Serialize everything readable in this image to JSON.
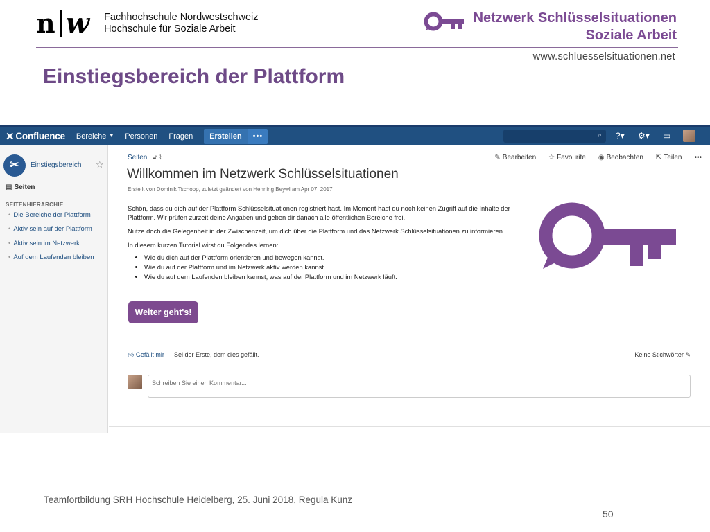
{
  "header": {
    "fhnw_mark": "n",
    "fhnw_mark_w": "w",
    "fhnw_line1": "Fachhochschule Nordwestschweiz",
    "fhnw_line2": "Hochschule für Soziale Arbeit",
    "network_line1": "Netzwerk Schlüsselsituationen",
    "network_line2": "Soziale Arbeit",
    "network_url": "www.schluesselsituationen.net",
    "brand_color": "#7b4a93"
  },
  "slide": {
    "title": "Einstiegsbereich der Plattform",
    "footer": "Teamfortbildung SRH Hochschule Heidelberg, 25. Juni 2018, Regula Kunz",
    "page_number": "50"
  },
  "confluence": {
    "topbar": {
      "logo": "Confluence",
      "nav": [
        "Bereiche",
        "Personen",
        "Fragen"
      ],
      "create_label": "Erstellen",
      "more_label": "•••"
    },
    "sidebar": {
      "space_name": "Einstiegsbereich",
      "pages_label": "Seiten",
      "hierarchy_label": "SEITENHIERARCHIE",
      "tree": [
        "Die Bereiche der Plattform",
        "Aktiv sein auf der Plattform",
        "Aktiv sein im Netzwerk",
        "Auf dem Laufenden bleiben"
      ]
    },
    "page": {
      "breadcrumb": "Seiten",
      "actions": [
        "Bearbeiten",
        "Favourite",
        "Beobachten",
        "Teilen"
      ],
      "title": "Willkommen im Netzwerk Schlüsselsituationen",
      "byline": "Erstellt von Dominik Tschopp, zuletzt geändert von Henning Beywl am Apr 07, 2017",
      "paragraph1": "Schön, dass du dich auf der Plattform Schlüsselsituationen registriert hast. Im Moment hast du noch keinen Zugriff auf die Inhalte der Plattform. Wir prüfen zurzeit deine Angaben und geben dir danach alle öffentlichen Bereiche frei.",
      "paragraph2": "Nutze doch die Gelegenheit in der Zwischenzeit, um dich über die Plattform und das Netzwerk Schlüsselsituationen zu informieren.",
      "paragraph3": "In diesem kurzen Tutorial wirst du Folgendes lernen:",
      "bullets": [
        "Wie du dich auf der Plattform orientieren und bewegen kannst.",
        "Wie du auf der Plattform und im Netzwerk aktiv werden kannst.",
        "Wie du auf dem Laufenden bleiben kannst, was auf der Plattform und im Netzwerk läuft."
      ],
      "cta_label": "Weiter geht's!",
      "like_label": "Gefällt mir",
      "like_text": "Sei der Erste, dem dies gefällt.",
      "labels_text": "Keine Stichwörter",
      "comment_placeholder": "Schreiben Sie einen Kommentar..."
    }
  }
}
